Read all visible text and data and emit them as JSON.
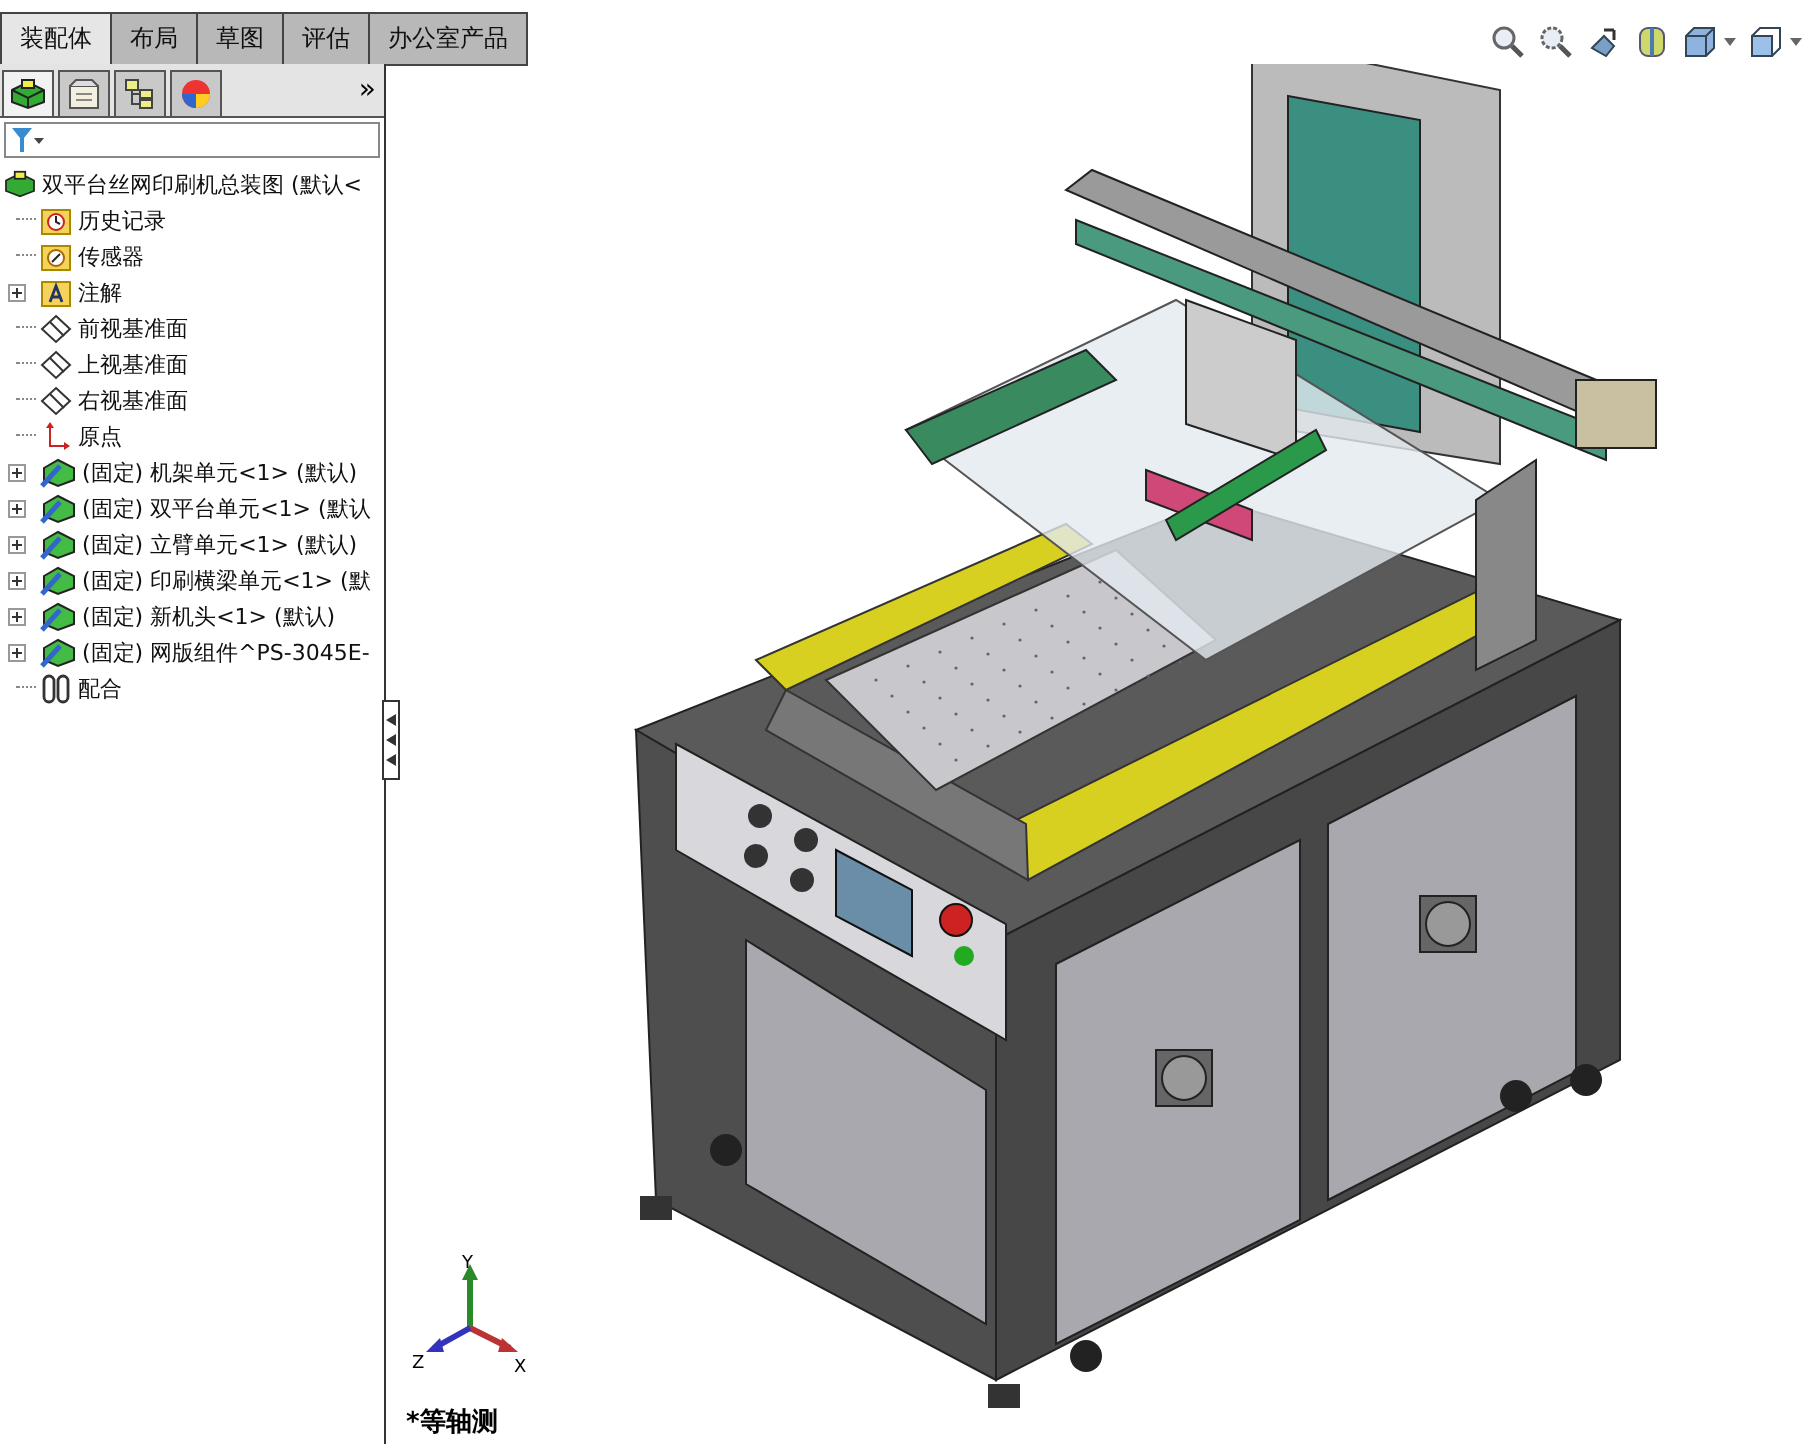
{
  "bottom_tabs": [
    {
      "label": "装配体",
      "selected": true
    },
    {
      "label": "布局",
      "selected": false
    },
    {
      "label": "草图",
      "selected": false
    },
    {
      "label": "评估",
      "selected": false
    },
    {
      "label": "办公室产品",
      "selected": false
    }
  ],
  "panel_tabs": [
    {
      "kind": "assembly",
      "selected": true
    },
    {
      "kind": "property",
      "selected": false
    },
    {
      "kind": "config",
      "selected": false
    },
    {
      "kind": "appearance",
      "selected": false
    }
  ],
  "panel_more": "»",
  "tree": {
    "label": "双平台丝网印刷机总装图 (默认<",
    "kind": "assembly",
    "children": [
      {
        "label": "历史记录",
        "kind": "history",
        "collapsed": false
      },
      {
        "label": "传感器",
        "kind": "sensor",
        "collapsed": false
      },
      {
        "label": "注解",
        "kind": "annotation",
        "collapsed": true
      },
      {
        "label": "前视基准面",
        "kind": "plane",
        "collapsed": false
      },
      {
        "label": "上视基准面",
        "kind": "plane",
        "collapsed": false
      },
      {
        "label": "右视基准面",
        "kind": "plane",
        "collapsed": false
      },
      {
        "label": "原点",
        "kind": "origin",
        "collapsed": false
      },
      {
        "label": "(固定) 机架单元<1> (默认)",
        "kind": "part",
        "collapsed": true
      },
      {
        "label": "(固定) 双平台单元<1> (默认",
        "kind": "part",
        "collapsed": true
      },
      {
        "label": "(固定) 立臂单元<1> (默认)",
        "kind": "part",
        "collapsed": true
      },
      {
        "label": "(固定) 印刷横梁单元<1> (默",
        "kind": "part",
        "collapsed": true
      },
      {
        "label": "(固定) 新机头<1> (默认)",
        "kind": "part",
        "collapsed": true
      },
      {
        "label": "(固定) 网版组件^PS-3045E-",
        "kind": "part",
        "collapsed": true
      },
      {
        "label": "配合",
        "kind": "mates",
        "collapsed": false
      }
    ]
  },
  "triad": {
    "x": "X",
    "y": "Y",
    "z": "Z"
  },
  "view_label": "*等轴测"
}
